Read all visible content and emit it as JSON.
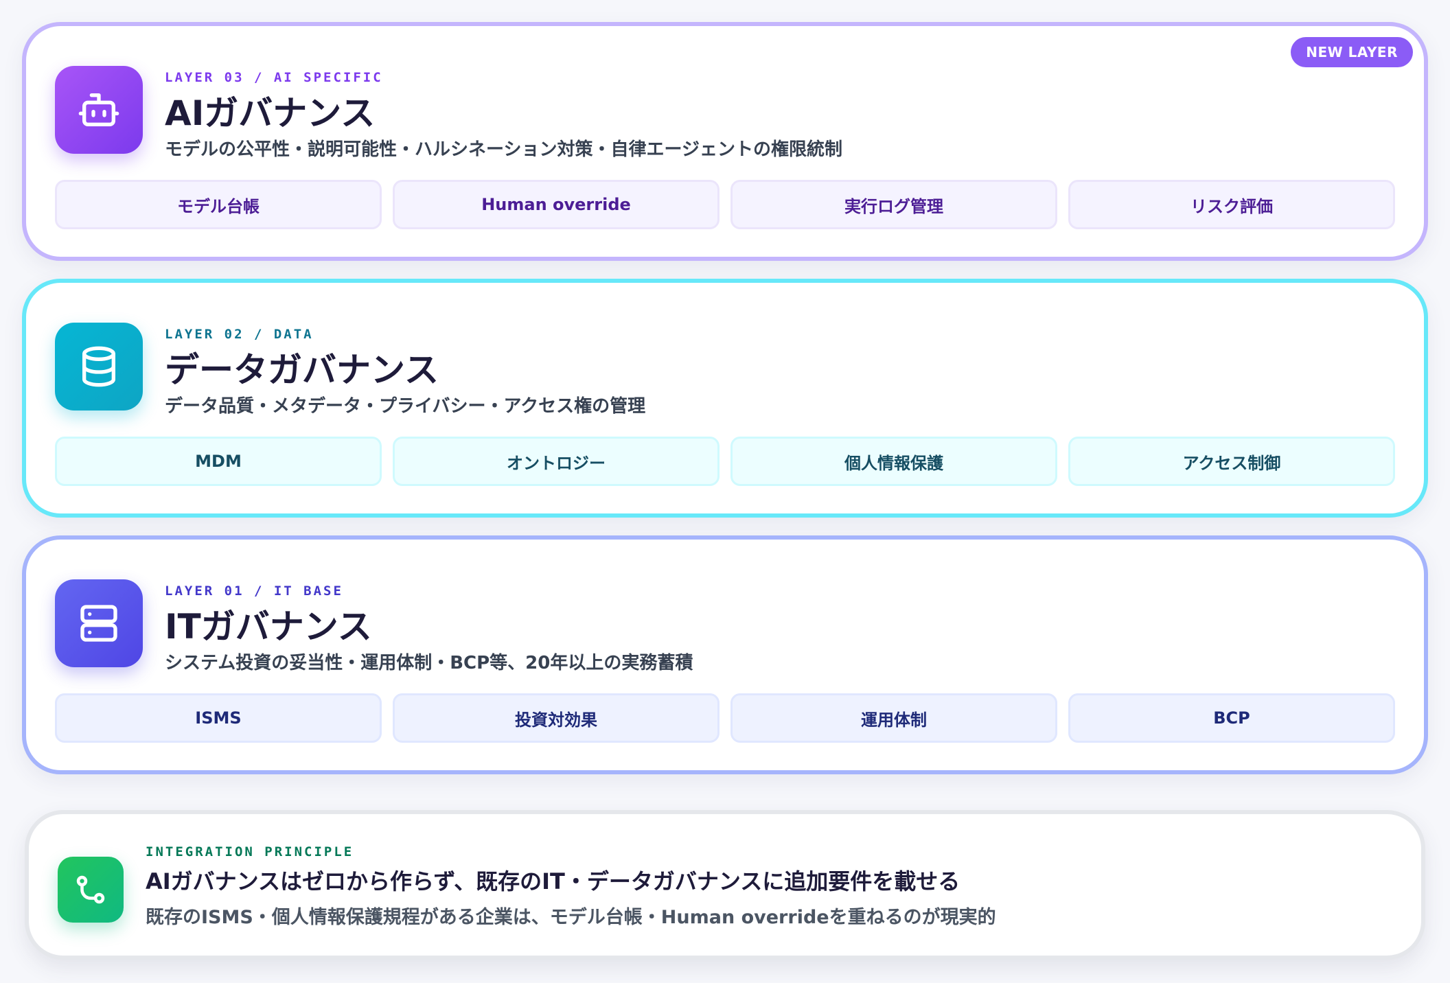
{
  "badges": {
    "new_layer": "NEW LAYER"
  },
  "layers": [
    {
      "eyebrow": "LAYER 03 / AI SPECIFIC",
      "title": "AIガバナンス",
      "subtitle": "モデルの公平性・説明可能性・ハルシネーション対策・自律エージェントの権限統制",
      "icon": "robot-icon",
      "accent": "#8b5cf6",
      "chips": [
        "モデル台帳",
        "Human override",
        "実行ログ管理",
        "リスク評価"
      ]
    },
    {
      "eyebrow": "LAYER 02 / DATA",
      "title": "データガバナンス",
      "subtitle": "データ品質・メタデータ・プライバシー・アクセス権の管理",
      "icon": "database-icon",
      "accent": "#06b6d4",
      "chips": [
        "MDM",
        "オントロジー",
        "個人情報保護",
        "アクセス制御"
      ]
    },
    {
      "eyebrow": "LAYER 01 / IT BASE",
      "title": "ITガバナンス",
      "subtitle": "システム投資の妥当性・運用体制・BCP等、20年以上の実務蓄積",
      "icon": "server-icon",
      "accent": "#6366f1",
      "chips": [
        "ISMS",
        "投資対効果",
        "運用体制",
        "BCP"
      ]
    }
  ],
  "principle": {
    "eyebrow": "INTEGRATION PRINCIPLE",
    "title": "AIガバナンスはゼロから作らず、既存のIT・データガバナンスに追加要件を載せる",
    "description": "既存のISMS・個人情報保護規程がある企業は、モデル台帳・Human overrideを重ねるのが現実的",
    "icon": "git-merge-icon",
    "accent": "#10b981"
  }
}
